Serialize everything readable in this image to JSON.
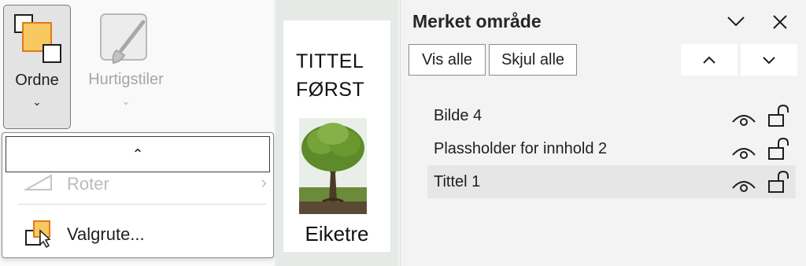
{
  "ribbon": {
    "arrange": {
      "label": "Ordne",
      "chevron": "⌄",
      "icon": "arrange-icon"
    },
    "quick_styles": {
      "label": "Hurtigstiler",
      "chevron": "⌄",
      "icon": "quick-styles-brush-icon"
    }
  },
  "dropdown": {
    "scroll_up": "⌃",
    "items": [
      {
        "label": "Roter",
        "icon": "rotate-icon",
        "arrow": "›",
        "disabled": true
      },
      {
        "label": "Valgrute...",
        "icon": "selection-pane-icon",
        "disabled": false
      }
    ]
  },
  "slide": {
    "title_line1": "TITTEL",
    "title_line2": "FØRST",
    "image": "tree-image",
    "caption": "Eiketre"
  },
  "selection_pane": {
    "title": "Merket område",
    "show_all": "Vis alle",
    "hide_all": "Skjul alle",
    "items": [
      {
        "name": "Bilde 4",
        "selected": false
      },
      {
        "name": "Plassholder for innhold 2",
        "selected": false
      },
      {
        "name": "Tittel 1",
        "selected": true
      }
    ]
  },
  "colors": {
    "accent_orange": "#e07b17",
    "arrange_fill": "#f6c85f",
    "selected_row": "#e6e6e6"
  }
}
